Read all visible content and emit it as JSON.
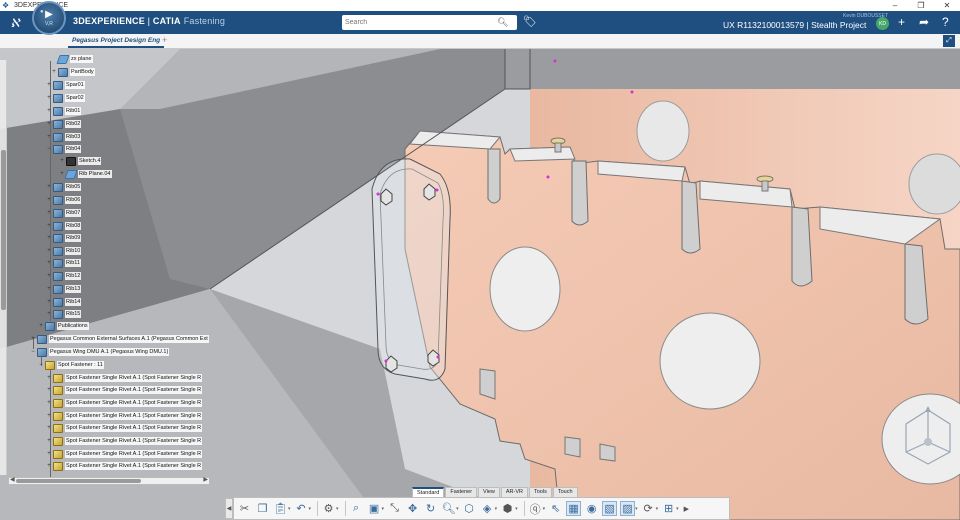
{
  "os": {
    "title": "3DEXPERIENCE"
  },
  "header": {
    "brand": "3DEXPERIENCE",
    "separator": " | ",
    "product": "CATIA",
    "app": "Fastening",
    "search_placeholder": "Search",
    "user": "Kevin DUBOUSSET",
    "ux_label": "UX R1132100013579 | Stealth Project",
    "avatar_initials": "KD",
    "compass_label": "V,R"
  },
  "tabs": [
    {
      "label": "Pegasus Project Design Eng"
    }
  ],
  "tree": {
    "rows": [
      {
        "label": "zx plane",
        "icon": "plane"
      },
      {
        "label": "PartBody",
        "icon": "blue"
      },
      {
        "label": "Spar01",
        "icon": "blue"
      },
      {
        "label": "Spar02",
        "icon": "blue"
      },
      {
        "label": "Rib01",
        "icon": "blue"
      },
      {
        "label": "Rib02",
        "icon": "blue"
      },
      {
        "label": "Rib03",
        "icon": "blue"
      },
      {
        "label": "Rib04",
        "icon": "blue"
      },
      {
        "label": "Sketch.4",
        "icon": "sketch"
      },
      {
        "label": "Rib Plane.04",
        "icon": "plane"
      },
      {
        "label": "Rib05",
        "icon": "blue"
      },
      {
        "label": "Rib06",
        "icon": "blue"
      },
      {
        "label": "Rib07",
        "icon": "blue"
      },
      {
        "label": "Rib08",
        "icon": "blue"
      },
      {
        "label": "Rib09",
        "icon": "blue"
      },
      {
        "label": "Rib10",
        "icon": "blue"
      },
      {
        "label": "Rib11",
        "icon": "blue"
      },
      {
        "label": "Rib12",
        "icon": "blue"
      },
      {
        "label": "Rib13",
        "icon": "blue"
      },
      {
        "label": "Rib14",
        "icon": "blue"
      },
      {
        "label": "Rib15",
        "icon": "blue"
      },
      {
        "label": "Publications",
        "icon": "blue"
      },
      {
        "label": "Pegasus Common External Surfaces A.1 (Pegasus Common Ext",
        "icon": "blue"
      },
      {
        "label": "Pegasus Wing DMU A.1 (Pegasus Wing DMU.1)",
        "icon": "blue"
      },
      {
        "label": "Spot Fastener : 11",
        "icon": "yellow"
      },
      {
        "label": "Spot Fastener Single Rivet A.1 (Spot Fastener Single R",
        "icon": "yellow"
      },
      {
        "label": "Spot Fastener Single Rivet A.1 (Spot Fastener Single R",
        "icon": "yellow"
      },
      {
        "label": "Spot Fastener Single Rivet A.1 (Spot Fastener Single R",
        "icon": "yellow"
      },
      {
        "label": "Spot Fastener Single Rivet A.1 (Spot Fastener Single R",
        "icon": "yellow"
      },
      {
        "label": "Spot Fastener Single Rivet A.1 (Spot Fastener Single R",
        "icon": "yellow"
      },
      {
        "label": "Spot Fastener Single Rivet A.1 (Spot Fastener Single R",
        "icon": "yellow"
      },
      {
        "label": "Spot Fastener Single Rivet A.1 (Spot Fastener Single R",
        "icon": "yellow"
      },
      {
        "label": "Spot Fastener Single Rivet A.1 (Spot Fastener Single R",
        "icon": "yellow"
      }
    ]
  },
  "workbench_tabs": [
    {
      "label": "Standard",
      "active": true
    },
    {
      "label": "Fastener",
      "active": false
    },
    {
      "label": "View",
      "active": false
    },
    {
      "label": "AR-VR",
      "active": false
    },
    {
      "label": "Tools",
      "active": false
    },
    {
      "label": "Touch",
      "active": false
    }
  ],
  "toolbar": {
    "icons": [
      "cut-icon",
      "copy-icon",
      "paste-icon",
      "undo-icon",
      "settings-gear-icon",
      "zoom-icon",
      "view-cube-icon",
      "fit-all-icon",
      "pan-icon",
      "rotate-icon",
      "search-zoom-icon",
      "iso-view-icon",
      "render-style-icon",
      "hide-show-icon",
      "help-icon",
      "selection-icon",
      "visualization-icon",
      "capture-icon",
      "3d-section-icon",
      "update-icon",
      "layout-icon"
    ]
  },
  "colors": {
    "header_bg": "#1f4f80",
    "rib_face": "#f2c4ae",
    "skin_gray": "#8d8f93",
    "accent_magenta": "#d62fd6"
  }
}
